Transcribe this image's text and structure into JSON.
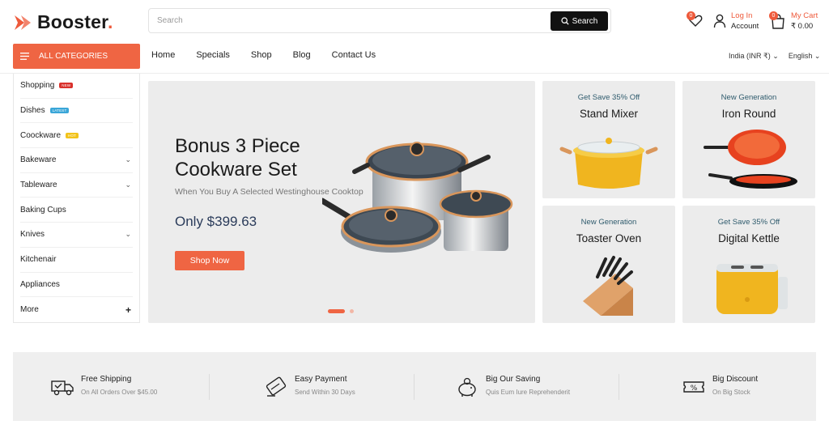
{
  "brand": {
    "name": "Booster",
    "dot": ".",
    "accent": "#ee5a3b"
  },
  "search": {
    "placeholder": "Search",
    "button_label": "Search"
  },
  "header": {
    "wishlist_count": "0",
    "account": {
      "line1": "Log In",
      "line2": "Account"
    },
    "cart": {
      "count": "0",
      "line1": "My Cart",
      "line2": "₹ 0.00"
    }
  },
  "nav": {
    "all_categories": "ALL CATEGORIES",
    "links": [
      "Home",
      "Specials",
      "Shop",
      "Blog",
      "Contact Us"
    ],
    "currency": "India (INR ₹)",
    "language": "English"
  },
  "sidebar": {
    "items": [
      {
        "label": "Shopping",
        "tag": "NEW",
        "tag_color": "#d9312c"
      },
      {
        "label": "Dishes",
        "tag": "LATEST",
        "tag_color": "#3aa6d8"
      },
      {
        "label": "Coockware",
        "tag": "HOT",
        "tag_color": "#f2c31a"
      },
      {
        "label": "Bakeware",
        "dropdown": true
      },
      {
        "label": "Tableware",
        "dropdown": true
      },
      {
        "label": "Baking Cups"
      },
      {
        "label": "Knives",
        "dropdown": true
      },
      {
        "label": "Kitchenair"
      },
      {
        "label": "Appliances"
      },
      {
        "label": "More",
        "plus": true
      }
    ]
  },
  "hero": {
    "title": "Bonus 3 Piece Cookware Set",
    "subtitle": "When You Buy A Selected Westinghouse Cooktop",
    "price": "Only $399.63",
    "button": "Shop Now",
    "slide_index": 1,
    "slide_count": 2
  },
  "promos": [
    {
      "kicker": "Get Save 35% Off",
      "title": "Stand Mixer",
      "icon": "pot-icon"
    },
    {
      "kicker": "New Generation",
      "title": "Iron Round",
      "icon": "pan-icon"
    },
    {
      "kicker": "New Generation",
      "title": "Toaster Oven",
      "icon": "knife-block-icon"
    },
    {
      "kicker": "Get Save 35% Off",
      "title": "Digital Kettle",
      "icon": "toaster-icon"
    }
  ],
  "services": [
    {
      "title": "Free Shipping",
      "subtitle": "On All Orders Over $45.00",
      "icon": "truck-icon"
    },
    {
      "title": "Easy Payment",
      "subtitle": "Send Within 30 Days",
      "icon": "card-icon"
    },
    {
      "title": "Big Our Saving",
      "subtitle": "Quis Eum Iure Reprehenderit",
      "icon": "piggy-bank-icon"
    },
    {
      "title": "Big Discount",
      "subtitle": "On Big Stock",
      "icon": "discount-icon"
    }
  ]
}
